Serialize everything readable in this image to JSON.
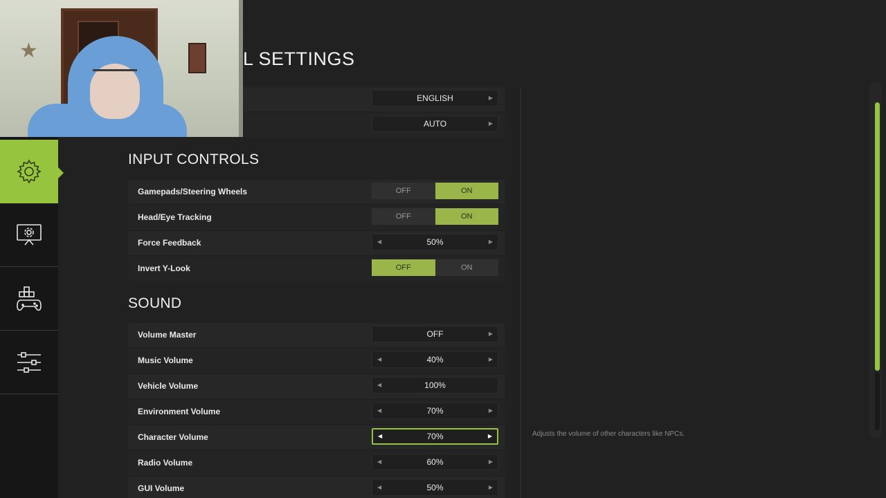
{
  "page": {
    "title": "L SETTINGS"
  },
  "colors": {
    "accent": "#96c43e",
    "toggle_on": "#9ab54a",
    "background": "#212121"
  },
  "sidebar": {
    "items": [
      {
        "name": "general-settings",
        "icon": "gear-icon",
        "active": true
      },
      {
        "name": "display-settings",
        "icon": "monitor-gear-icon",
        "active": false
      },
      {
        "name": "controls-settings",
        "icon": "gamepad-keys-icon",
        "active": false
      },
      {
        "name": "audio-settings",
        "icon": "sliders-icon",
        "active": false
      }
    ]
  },
  "general": {
    "rows": [
      {
        "value": "ENGLISH"
      },
      {
        "value": "AUTO"
      }
    ]
  },
  "input_controls": {
    "title": "INPUT CONTROLS",
    "gamepads": {
      "label": "Gamepads/Steering Wheels",
      "off": "OFF",
      "on": "ON",
      "selected": "ON"
    },
    "head_eye": {
      "label": "Head/Eye Tracking",
      "off": "OFF",
      "on": "ON",
      "selected": "ON"
    },
    "force_feedback": {
      "label": "Force Feedback",
      "value": "50%"
    },
    "invert_y": {
      "label": "Invert Y-Look",
      "off": "OFF",
      "on": "ON",
      "selected": "OFF"
    }
  },
  "sound": {
    "title": "SOUND",
    "volume_master": {
      "label": "Volume Master",
      "value": "OFF"
    },
    "music": {
      "label": "Music Volume",
      "value": "40%"
    },
    "vehicle": {
      "label": "Vehicle Volume",
      "value": "100%"
    },
    "environment": {
      "label": "Environment Volume",
      "value": "70%"
    },
    "character": {
      "label": "Character Volume",
      "value": "70%"
    },
    "radio": {
      "label": "Radio Volume",
      "value": "60%"
    },
    "gui": {
      "label": "GUI Volume",
      "value": "50%"
    }
  },
  "help": {
    "text": "Adjusts the volume of other characters like NPCs."
  }
}
